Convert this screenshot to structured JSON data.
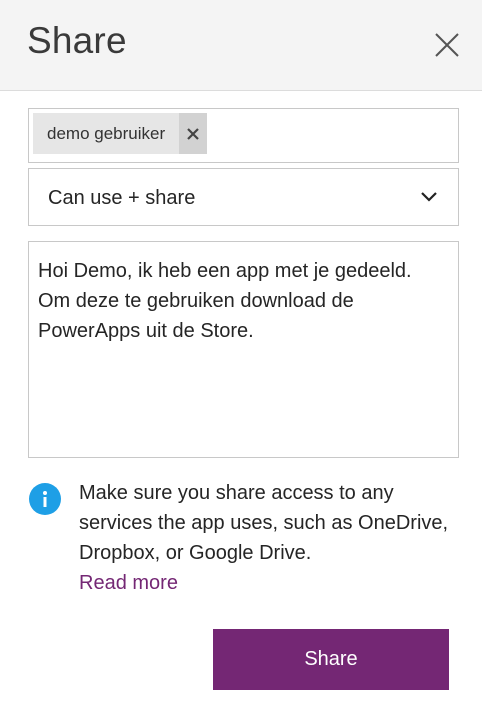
{
  "header": {
    "title": "Share",
    "close_icon": "close-icon"
  },
  "recipients": {
    "items": [
      {
        "name": "demo gebruiker",
        "remove_icon": "remove-x-icon"
      }
    ]
  },
  "permission": {
    "selected": "Can use + share",
    "chevron_icon": "chevron-down-icon"
  },
  "message": {
    "text": "Hoi Demo, ik heb een app met je gedeeld. Om deze te gebruiken download de PowerApps uit de Store."
  },
  "notice": {
    "icon": "info-icon",
    "text": "Make sure you share access to any services the app uses, such as OneDrive, Dropbox, or Google Drive.",
    "link_label": "Read more"
  },
  "actions": {
    "share_label": "Share"
  },
  "colors": {
    "accent": "#742774",
    "info": "#1e9fe6",
    "header_bg": "#f4f4f4",
    "chip_bg": "#e6e6e6"
  }
}
